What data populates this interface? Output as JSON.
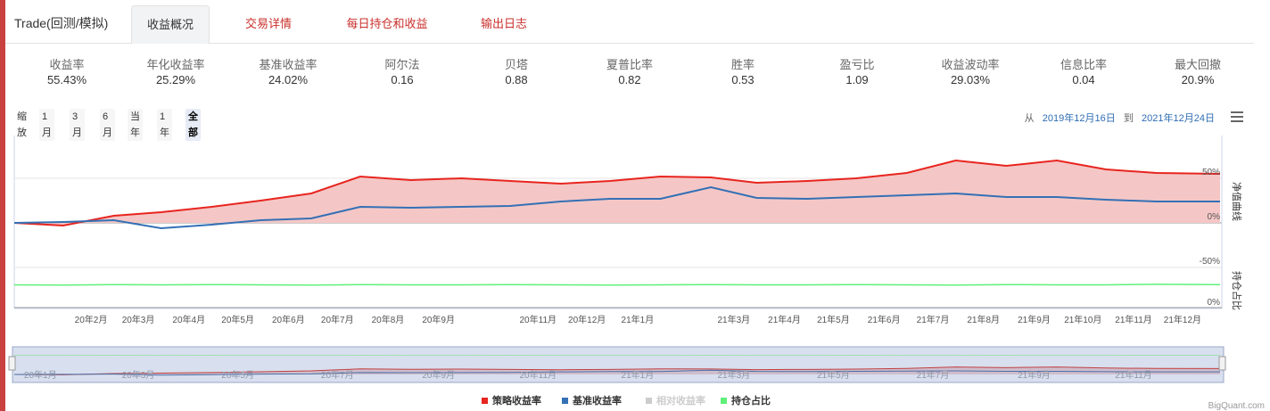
{
  "header": {
    "title": "Trade(回测/模拟)",
    "tabs": [
      {
        "label": "收益概况",
        "active": true
      },
      {
        "label": "交易详情",
        "active": false
      },
      {
        "label": "每日持仓和收益",
        "active": false
      },
      {
        "label": "输出日志",
        "active": false
      }
    ]
  },
  "stats": [
    {
      "label": "收益率",
      "value": "55.43%"
    },
    {
      "label": "年化收益率",
      "value": "25.29%"
    },
    {
      "label": "基准收益率",
      "value": "24.02%"
    },
    {
      "label": "阿尔法",
      "value": "0.16"
    },
    {
      "label": "贝塔",
      "value": "0.88"
    },
    {
      "label": "夏普比率",
      "value": "0.82"
    },
    {
      "label": "胜率",
      "value": "0.53"
    },
    {
      "label": "盈亏比",
      "value": "1.09"
    },
    {
      "label": "收益波动率",
      "value": "29.03%"
    },
    {
      "label": "信息比率",
      "value": "0.04"
    },
    {
      "label": "最大回撤",
      "value": "20.9%"
    }
  ],
  "zoom": {
    "label": "缩放",
    "buttons": [
      {
        "label": "1月",
        "active": false
      },
      {
        "label": "3月",
        "active": false
      },
      {
        "label": "6月",
        "active": false
      },
      {
        "label": "当年",
        "active": false
      },
      {
        "label": "1年",
        "active": false
      },
      {
        "label": "全部",
        "active": true
      }
    ]
  },
  "range": {
    "from_label": "从",
    "from": "2019年12月16日",
    "to_label": "到",
    "to": "2021年12月24日"
  },
  "colors": {
    "strategy": "#e8251f",
    "benchmark": "#3470b5",
    "relative": "#cccccc",
    "position": "#5ff07a",
    "accent": "#c9302c"
  },
  "chart_data": {
    "type": "line",
    "x_range": [
      "2019-12-16",
      "2021-12-24"
    ],
    "x_ticks": [
      "20年2月",
      "20年3月",
      "20年4月",
      "20年5月",
      "20年6月",
      "20年7月",
      "20年8月",
      "20年9月",
      "20年11月",
      "20年12月",
      "21年1月",
      "21年3月",
      "21年4月",
      "21年5月",
      "21年6月",
      "21年7月",
      "21年8月",
      "21年9月",
      "21年10月",
      "21年11月",
      "21年12月"
    ],
    "panels": [
      {
        "ylabel": "净值曲线",
        "ylim": [
          -50,
          50
        ],
        "y_ticks": [
          "50%",
          "0%",
          "-50%"
        ]
      },
      {
        "ylabel": "持仓占比",
        "y_ticks": [
          "0%"
        ]
      }
    ],
    "x": [
      "2019-12-16",
      "2020-01-15",
      "2020-02-15",
      "2020-03-15",
      "2020-04-15",
      "2020-05-15",
      "2020-06-15",
      "2020-07-15",
      "2020-08-15",
      "2020-09-15",
      "2020-10-15",
      "2020-11-15",
      "2020-12-15",
      "2021-01-15",
      "2021-02-15",
      "2021-03-15",
      "2021-04-15",
      "2021-05-15",
      "2021-06-15",
      "2021-07-15",
      "2021-08-15",
      "2021-09-15",
      "2021-10-15",
      "2021-11-15",
      "2021-12-24"
    ],
    "series": [
      {
        "name": "策略收益率",
        "values": [
          0,
          -3,
          8,
          12,
          18,
          25,
          33,
          52,
          48,
          50,
          47,
          44,
          47,
          52,
          51,
          45,
          47,
          50,
          56,
          70,
          64,
          70,
          60,
          56,
          55
        ]
      },
      {
        "name": "基准收益率",
        "values": [
          0,
          1,
          3,
          -6,
          -2,
          3,
          5,
          18,
          17,
          18,
          19,
          24,
          27,
          27,
          40,
          28,
          27,
          29,
          31,
          33,
          29,
          29,
          26,
          24,
          24
        ]
      },
      {
        "name": "相对收益率",
        "values": []
      },
      {
        "name": "持仓占比",
        "values": [
          0.85,
          0.84,
          0.86,
          0.85,
          0.86,
          0.85,
          0.84,
          0.86,
          0.85,
          0.85,
          0.86,
          0.85,
          0.84,
          0.85,
          0.86,
          0.85,
          0.85,
          0.86,
          0.85,
          0.84,
          0.86,
          0.85,
          0.85,
          0.87,
          0.86
        ]
      }
    ],
    "navigator_ticks": [
      "20年1月",
      "20年3月",
      "20年5月",
      "20年7月",
      "20年9月",
      "20年11月",
      "21年1月",
      "21年3月",
      "21年5月",
      "21年7月",
      "21年9月",
      "21年11月"
    ],
    "legend": [
      {
        "name": "策略收益率",
        "color": "#e8251f",
        "visible": true
      },
      {
        "name": "基准收益率",
        "color": "#3470b5",
        "visible": true
      },
      {
        "name": "相对收益率",
        "color": "#cccccc",
        "visible": false
      },
      {
        "name": "持仓占比",
        "color": "#5ff07a",
        "visible": true
      }
    ]
  },
  "credit": "BigQuant.com"
}
